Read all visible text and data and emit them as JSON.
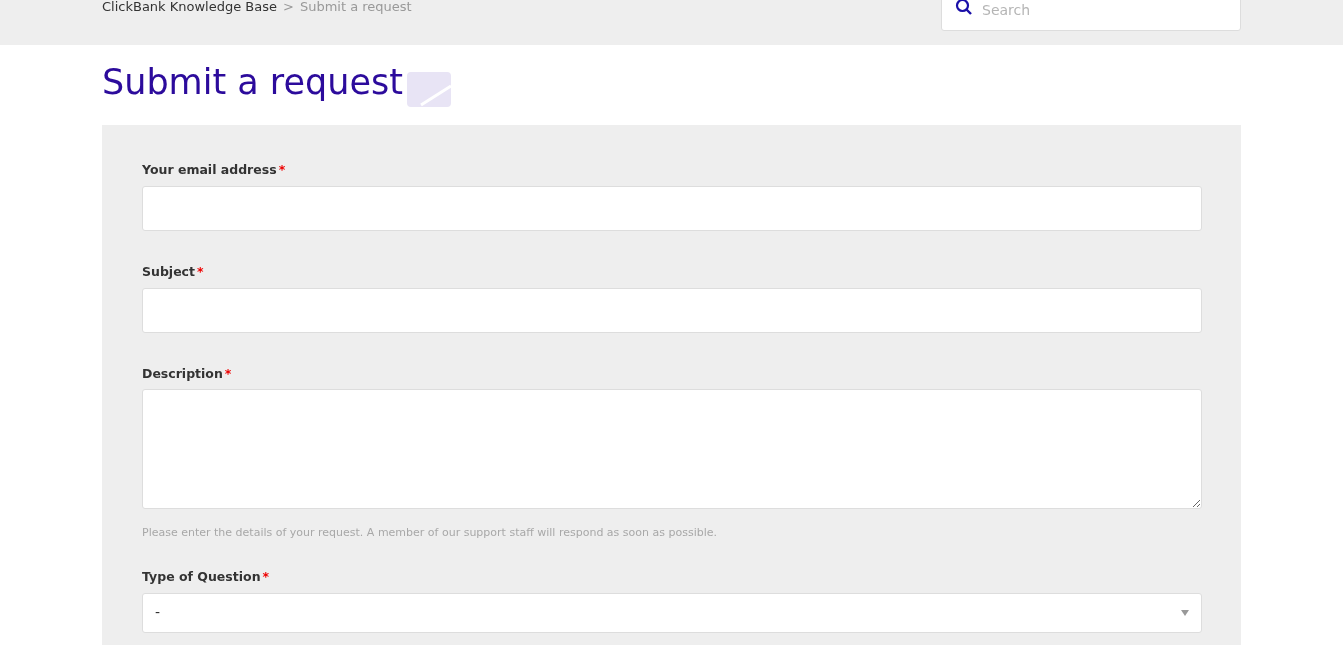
{
  "breadcrumb": [
    {
      "label": "ClickBank Knowledge Base",
      "current": false
    },
    {
      "label": "Submit a request",
      "current": true
    }
  ],
  "breadcrumb_separator": ">",
  "search": {
    "placeholder": "Search"
  },
  "title": "Submit a request",
  "form": {
    "fields": [
      {
        "kind": "input",
        "label": "Your email address",
        "required_mark": "*"
      },
      {
        "kind": "input",
        "label": "Subject",
        "required_mark": "*"
      },
      {
        "kind": "textarea",
        "label": "Description",
        "required_mark": "*",
        "hint": "Please enter the details of your request. A member of our support staff will respond as soon as possible."
      },
      {
        "kind": "select",
        "label": "Type of Question",
        "required_mark": "*",
        "value": "-"
      }
    ]
  }
}
